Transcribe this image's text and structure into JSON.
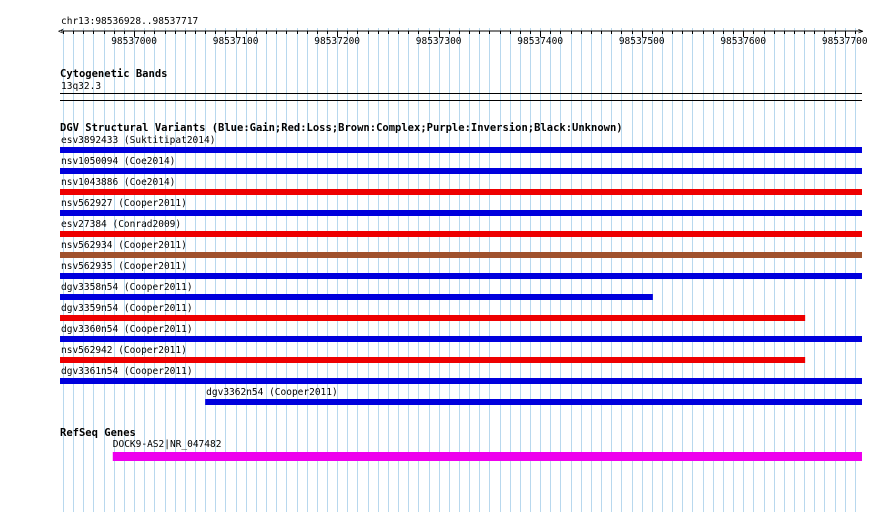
{
  "ruler": {
    "label": "chr13:98536928..98537717",
    "start": 98536928,
    "end": 98537717,
    "ticks": [
      98537000,
      98537100,
      98537200,
      98537300,
      98537400,
      98537500,
      98537600,
      98537700
    ]
  },
  "cytoband": {
    "title": "Cytogenetic Bands",
    "band": "13q32.3"
  },
  "dgv": {
    "title": "DGV Structural Variants (Blue:Gain;Red:Loss;Brown:Complex;Purple:Inversion;Black:Unknown)",
    "colors": {
      "gain": "#0000dd",
      "loss": "#ee0000",
      "complex": "#a0522d"
    },
    "features": [
      {
        "label": "esv3892433 (Suktitipat2014)",
        "type": "gain",
        "start": 98536928,
        "end": 98537717
      },
      {
        "label": "nsv1050094 (Coe2014)",
        "type": "gain",
        "start": 98536928,
        "end": 98537717
      },
      {
        "label": "nsv1043886 (Coe2014)",
        "type": "loss",
        "start": 98536928,
        "end": 98537717
      },
      {
        "label": "nsv562927 (Cooper2011)",
        "type": "gain",
        "start": 98536928,
        "end": 98537717
      },
      {
        "label": "esv27384 (Conrad2009)",
        "type": "loss",
        "start": 98536928,
        "end": 98537717
      },
      {
        "label": "nsv562934 (Cooper2011)",
        "type": "complex",
        "start": 98536928,
        "end": 98537717
      },
      {
        "label": "nsv562935 (Cooper2011)",
        "type": "gain",
        "start": 98536928,
        "end": 98537717
      },
      {
        "label": "dgv3358n54 (Cooper2011)",
        "type": "gain",
        "start": 98536928,
        "end": 98537511
      },
      {
        "label": "dgv3359n54 (Cooper2011)",
        "type": "loss",
        "start": 98536928,
        "end": 98537661
      },
      {
        "label": "dgv3360n54 (Cooper2011)",
        "type": "gain",
        "start": 98536928,
        "end": 98537717
      },
      {
        "label": "nsv562942 (Cooper2011)",
        "type": "loss",
        "start": 98536928,
        "end": 98537661
      },
      {
        "label": "dgv3361n54 (Cooper2011)",
        "type": "gain",
        "start": 98536928,
        "end": 98537717
      },
      {
        "label": "dgv3362n54 (Cooper2011)",
        "type": "gain",
        "start": 98537071,
        "end": 98537717
      }
    ]
  },
  "refseq": {
    "title": "RefSeq Genes",
    "color": "#ee00ee",
    "features": [
      {
        "label": "DOCK9-AS2|NR_047482",
        "start": 98536979,
        "end": 98537717
      }
    ]
  }
}
